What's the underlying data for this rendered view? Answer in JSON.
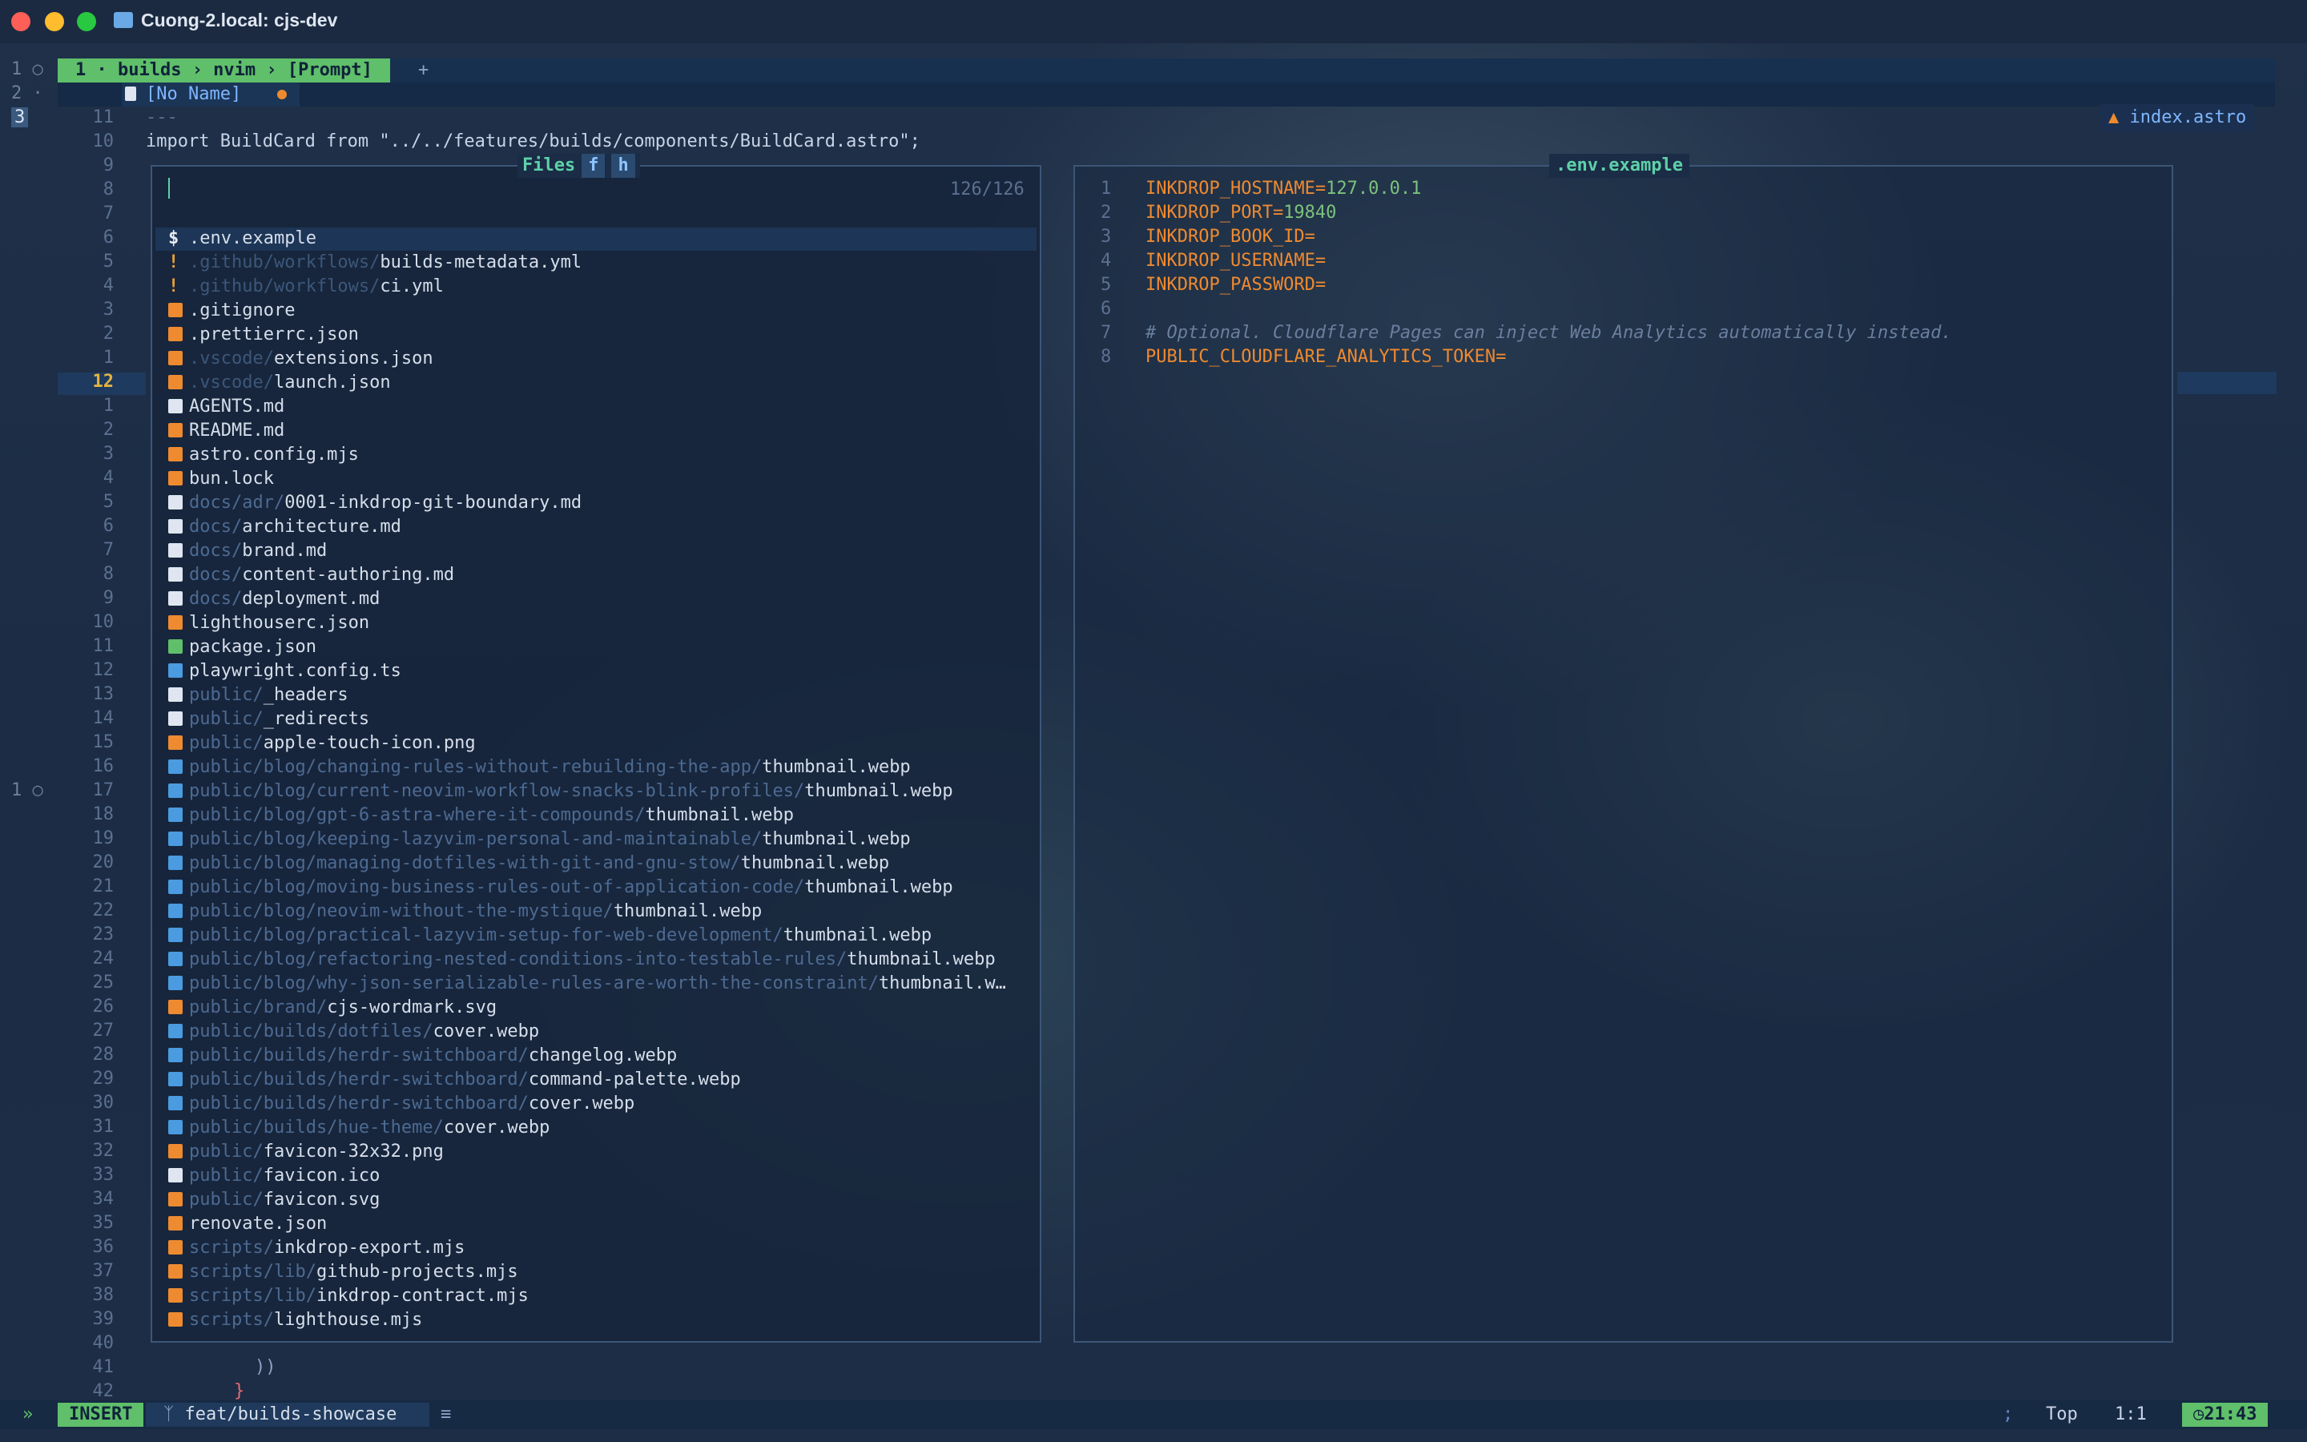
{
  "window": {
    "title": "Cuong-2.local: cjs-dev"
  },
  "tmux": {
    "window_label": "1 · builds › nvim › [Prompt]",
    "new_tab": "+",
    "panes": [
      "1 ○",
      "2 ·",
      "3"
    ],
    "pane_lower": "1 ○"
  },
  "buffer": {
    "name": "[No Name]",
    "tab_file": "index.astro"
  },
  "editor": {
    "line_numbers_top": [
      "11",
      "10",
      "9",
      "8",
      "7",
      "6",
      "5",
      "4",
      "3",
      "2",
      "1",
      "12",
      "1",
      "2",
      "3",
      "4",
      "5",
      "6",
      "7",
      "8",
      "9",
      "10",
      "11",
      "12",
      "13",
      "14",
      "15",
      "16",
      "17",
      "18",
      "19",
      "20",
      "21",
      "22",
      "23",
      "24",
      "25",
      "26",
      "27",
      "28",
      "29",
      "30",
      "31",
      "32",
      "33",
      "34",
      "35",
      "36",
      "37",
      "38",
      "39",
      "40",
      "41",
      "42"
    ],
    "line_frontmatter": "---",
    "line_import": "import BuildCard from \"../../features/builds/components/BuildCard.astro\";",
    "line_41": "))",
    "line_42": "}"
  },
  "picker": {
    "title": "Files",
    "key_f": "f",
    "key_h": "h",
    "count": "126/126",
    "items": [
      {
        "dir": "",
        "name": ".env.example",
        "icon": "dollar"
      },
      {
        "dir": ".github/workflows/",
        "name": "builds-metadata.yml",
        "icon": "excl"
      },
      {
        "dir": ".github/workflows/",
        "name": "ci.yml",
        "icon": "excl"
      },
      {
        "dir": "",
        "name": ".gitignore",
        "icon": "git"
      },
      {
        "dir": "",
        "name": ".prettierrc.json",
        "icon": "json"
      },
      {
        "dir": ".vscode/",
        "name": "extensions.json",
        "icon": "json"
      },
      {
        "dir": ".vscode/",
        "name": "launch.json",
        "icon": "json"
      },
      {
        "dir": "",
        "name": "AGENTS.md",
        "icon": "md"
      },
      {
        "dir": "",
        "name": "README.md",
        "icon": "readme"
      },
      {
        "dir": "",
        "name": "astro.config.mjs",
        "icon": "js"
      },
      {
        "dir": "",
        "name": "bun.lock",
        "icon": "json"
      },
      {
        "dir": "docs/adr/",
        "name": "0001-inkdrop-git-boundary.md",
        "icon": "md"
      },
      {
        "dir": "docs/",
        "name": "architecture.md",
        "icon": "md"
      },
      {
        "dir": "docs/",
        "name": "brand.md",
        "icon": "md"
      },
      {
        "dir": "docs/",
        "name": "content-authoring.md",
        "icon": "md"
      },
      {
        "dir": "docs/",
        "name": "deployment.md",
        "icon": "md"
      },
      {
        "dir": "",
        "name": "lighthouserc.json",
        "icon": "json"
      },
      {
        "dir": "",
        "name": "package.json",
        "icon": "node"
      },
      {
        "dir": "",
        "name": "playwright.config.ts",
        "icon": "ts"
      },
      {
        "dir": "public/",
        "name": "_headers",
        "icon": "file"
      },
      {
        "dir": "public/",
        "name": "_redirects",
        "icon": "file"
      },
      {
        "dir": "public/",
        "name": "apple-touch-icon.png",
        "icon": "png"
      },
      {
        "dir": "public/blog/changing-rules-without-rebuilding-the-app/",
        "name": "thumbnail.webp",
        "icon": "img"
      },
      {
        "dir": "public/blog/current-neovim-workflow-snacks-blink-profiles/",
        "name": "thumbnail.webp",
        "icon": "img"
      },
      {
        "dir": "public/blog/gpt-6-astra-where-it-compounds/",
        "name": "thumbnail.webp",
        "icon": "img"
      },
      {
        "dir": "public/blog/keeping-lazyvim-personal-and-maintainable/",
        "name": "thumbnail.webp",
        "icon": "img"
      },
      {
        "dir": "public/blog/managing-dotfiles-with-git-and-gnu-stow/",
        "name": "thumbnail.webp",
        "icon": "img"
      },
      {
        "dir": "public/blog/moving-business-rules-out-of-application-code/",
        "name": "thumbnail.webp",
        "icon": "img"
      },
      {
        "dir": "public/blog/neovim-without-the-mystique/",
        "name": "thumbnail.webp",
        "icon": "img"
      },
      {
        "dir": "public/blog/practical-lazyvim-setup-for-web-development/",
        "name": "thumbnail.webp",
        "icon": "img"
      },
      {
        "dir": "public/blog/refactoring-nested-conditions-into-testable-rules/",
        "name": "thumbnail.webp",
        "icon": "img"
      },
      {
        "dir": "public/blog/why-json-serializable-rules-are-worth-the-constraint/",
        "name": "thumbnail.w…",
        "icon": "img"
      },
      {
        "dir": "public/brand/",
        "name": "cjs-wordmark.svg",
        "icon": "svg"
      },
      {
        "dir": "public/builds/dotfiles/",
        "name": "cover.webp",
        "icon": "img"
      },
      {
        "dir": "public/builds/herdr-switchboard/",
        "name": "changelog.webp",
        "icon": "img"
      },
      {
        "dir": "public/builds/herdr-switchboard/",
        "name": "command-palette.webp",
        "icon": "img"
      },
      {
        "dir": "public/builds/herdr-switchboard/",
        "name": "cover.webp",
        "icon": "img"
      },
      {
        "dir": "public/builds/hue-theme/",
        "name": "cover.webp",
        "icon": "img"
      },
      {
        "dir": "public/",
        "name": "favicon-32x32.png",
        "icon": "png"
      },
      {
        "dir": "public/",
        "name": "favicon.ico",
        "icon": "file"
      },
      {
        "dir": "public/",
        "name": "favicon.svg",
        "icon": "svg"
      },
      {
        "dir": "",
        "name": "renovate.json",
        "icon": "json"
      },
      {
        "dir": "scripts/",
        "name": "inkdrop-export.mjs",
        "icon": "js"
      },
      {
        "dir": "scripts/lib/",
        "name": "github-projects.mjs",
        "icon": "js"
      },
      {
        "dir": "scripts/lib/",
        "name": "inkdrop-contract.mjs",
        "icon": "js"
      },
      {
        "dir": "scripts/",
        "name": "lighthouse.mjs",
        "icon": "js"
      }
    ]
  },
  "preview": {
    "title": ".env.example",
    "lines": [
      {
        "n": "1",
        "key": "INKDROP_HOSTNAME=",
        "val": "127.0.0.1"
      },
      {
        "n": "2",
        "key": "INKDROP_PORT=",
        "val": "19840"
      },
      {
        "n": "3",
        "key": "INKDROP_BOOK_ID=",
        "val": ""
      },
      {
        "n": "4",
        "key": "INKDROP_USERNAME=",
        "val": ""
      },
      {
        "n": "5",
        "key": "INKDROP_PASSWORD=",
        "val": ""
      },
      {
        "n": "6",
        "key": "",
        "val": ""
      },
      {
        "n": "7",
        "comment": "# Optional. Cloudflare Pages can inject Web Analytics automatically instead."
      },
      {
        "n": "8",
        "key": "PUBLIC_CLOUDFLARE_ANALYTICS_TOKEN=",
        "val": ""
      }
    ]
  },
  "statusline": {
    "prefix": "»",
    "mode": "INSERT",
    "branch": "feat/builds-showcase",
    "sep": ";",
    "position": "Top",
    "cursor": "1:1",
    "clock": "21:43"
  },
  "colors": {
    "accent": "#5fbf6a",
    "orange": "#ee8a30",
    "link": "#7fb6ff"
  }
}
